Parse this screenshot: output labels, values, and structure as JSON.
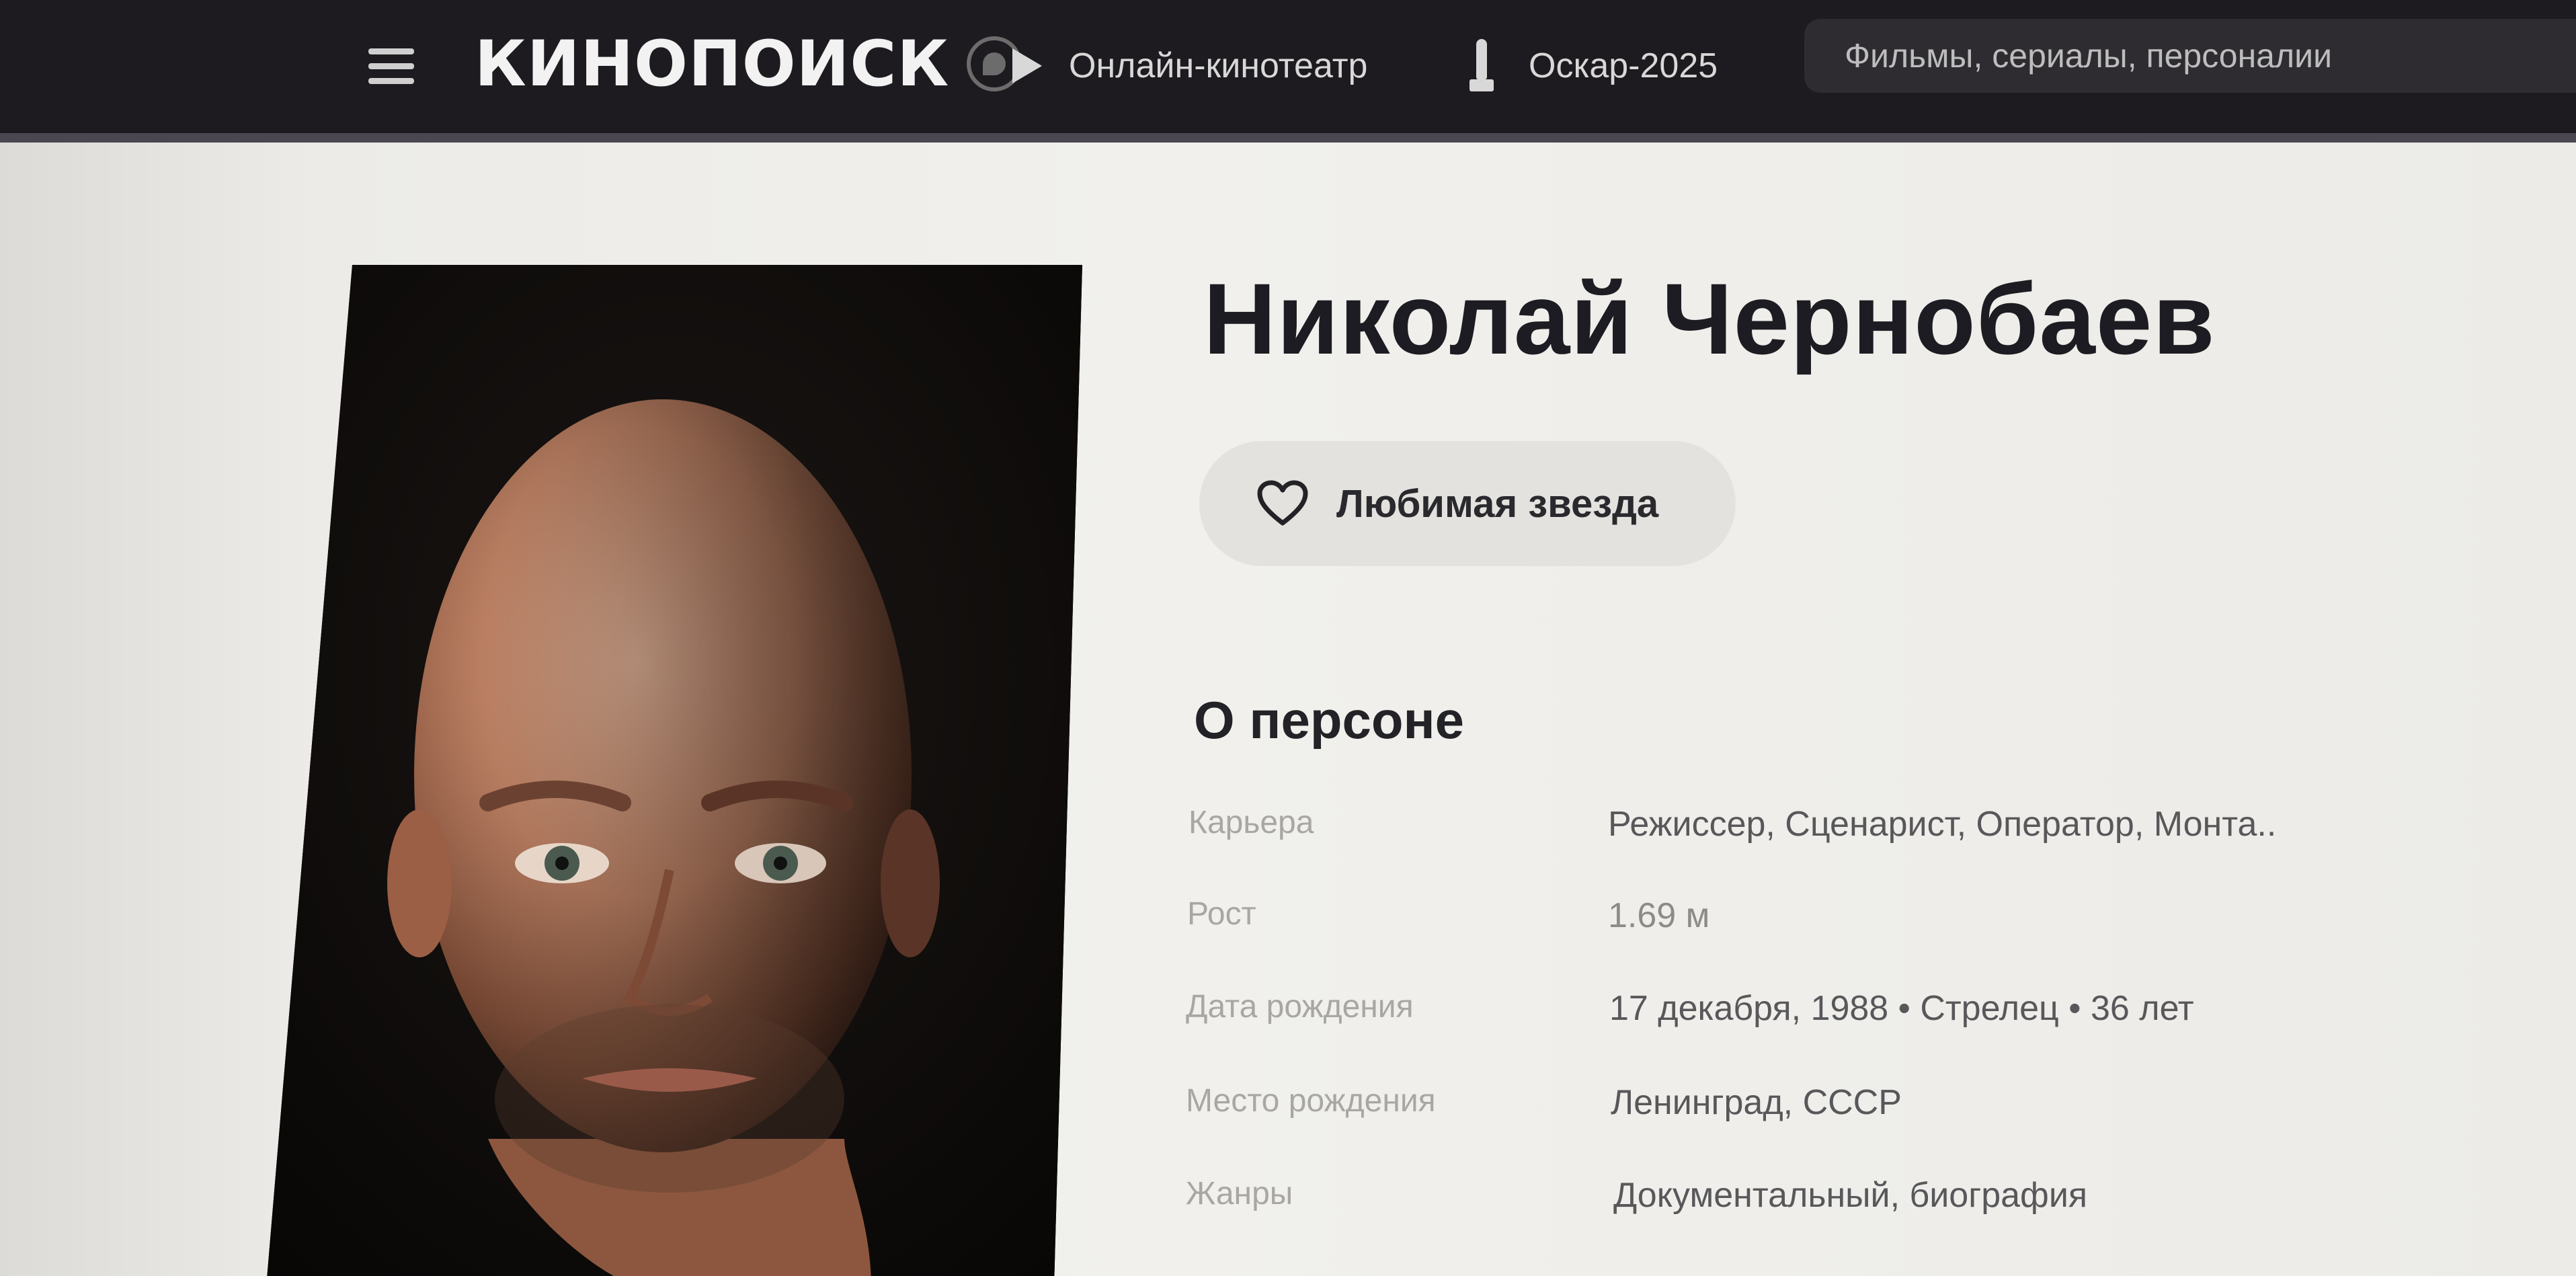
{
  "header": {
    "logo_text": "КИНОПОИСК",
    "nav": {
      "online_cinema": "Онлайн-кинотеатр",
      "oscar": "Оскар-2025"
    },
    "search": {
      "placeholder": "Фильмы, сериалы, персоналии"
    }
  },
  "person": {
    "name": "Николай Чернобаев",
    "favorite_label": "Любимая звезда"
  },
  "about": {
    "title": "О персоне",
    "rows": [
      {
        "label": "Карьера",
        "value": "Режиссер, Сценарист, Оператор, Монта.."
      },
      {
        "label": "Рост",
        "value": "1.69 м"
      },
      {
        "label": "Дата рождения",
        "value": "17 декабря, 1988 • Стрелец • 36 лет"
      },
      {
        "label": "Место рождения",
        "value": "Ленинград, СССР"
      },
      {
        "label": "Жанры",
        "value": "Документальный, биография"
      }
    ]
  },
  "icons": {
    "menu": "hamburger-menu-icon",
    "play": "play-icon",
    "oscar": "oscar-statuette-icon",
    "heart": "heart-outline-icon",
    "logo_badge": "logo-badge-icon"
  },
  "colors": {
    "header_bg": "#1d1b1f",
    "page_bg": "#f1f0ec",
    "name_text": "#1d1c22",
    "fav_button_bg": "#e3e2de"
  }
}
